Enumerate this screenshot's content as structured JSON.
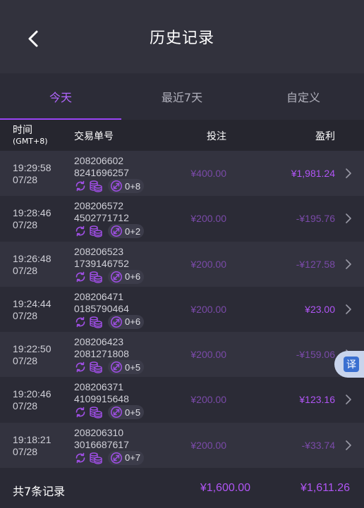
{
  "header": {
    "title": "历史记录"
  },
  "tabs": [
    {
      "label": "今天",
      "active": true
    },
    {
      "label": "最近7天",
      "active": false
    },
    {
      "label": "自定义",
      "active": false
    }
  ],
  "columns": {
    "time": "时间",
    "time_sub": "(GMT+8)",
    "order": "交易单号",
    "bet": "投注",
    "profit": "盈利"
  },
  "rows": [
    {
      "time": "19:29:58",
      "date": "07/28",
      "order_a": "208206602",
      "order_b": "8241696257",
      "count": "0+8",
      "bet": "¥400.00",
      "profit": "¥1,981.24",
      "positive": true
    },
    {
      "time": "19:28:46",
      "date": "07/28",
      "order_a": "208206572",
      "order_b": "4502771712",
      "count": "0+2",
      "bet": "¥200.00",
      "profit": "-¥195.76",
      "positive": false
    },
    {
      "time": "19:26:48",
      "date": "07/28",
      "order_a": "208206523",
      "order_b": "1739146752",
      "count": "0+6",
      "bet": "¥200.00",
      "profit": "-¥127.58",
      "positive": false
    },
    {
      "time": "19:24:44",
      "date": "07/28",
      "order_a": "208206471",
      "order_b": "0185790464",
      "count": "0+6",
      "bet": "¥200.00",
      "profit": "¥23.00",
      "positive": true
    },
    {
      "time": "19:22:50",
      "date": "07/28",
      "order_a": "208206423",
      "order_b": "2081271808",
      "count": "0+5",
      "bet": "¥200.00",
      "profit": "-¥159.06",
      "positive": false
    },
    {
      "time": "19:20:46",
      "date": "07/28",
      "order_a": "208206371",
      "order_b": "4109915648",
      "count": "0+5",
      "bet": "¥200.00",
      "profit": "¥123.16",
      "positive": true
    },
    {
      "time": "19:18:21",
      "date": "07/28",
      "order_a": "208206310",
      "order_b": "3016687617",
      "count": "0+7",
      "bet": "¥200.00",
      "profit": "-¥33.74",
      "positive": false
    }
  ],
  "footer": {
    "label": "共7条记录",
    "total_bet": "¥1,600.00",
    "total_profit": "¥1,611.26"
  },
  "translate": {
    "label": "译"
  },
  "colors": {
    "accent": "#9a44f5",
    "positive": "#b055f5",
    "muted": "#7a4aa8",
    "background": "#2a2a35"
  },
  "icons": [
    "back-arrow-icon",
    "refresh-icon",
    "coin-stack-icon",
    "expand-icon",
    "chevron-right-icon"
  ]
}
